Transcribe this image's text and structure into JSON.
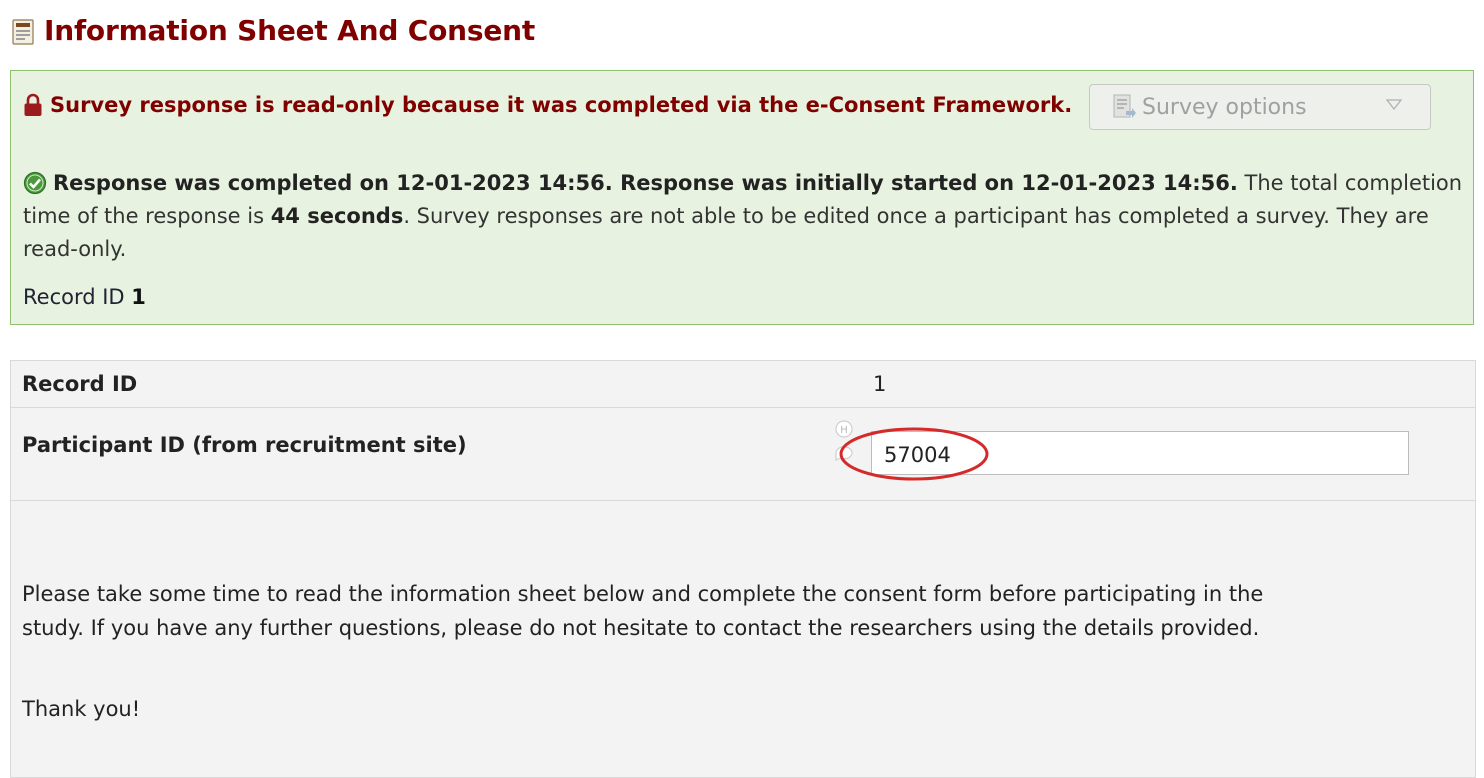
{
  "header": {
    "title": "Information Sheet And Consent"
  },
  "notice": {
    "readonly": "Survey response is read-only because it was completed via the e-Consent Framework.",
    "survey_options_label": "Survey options",
    "completed_bold": "Response was completed on 12-01-2023 14:56. Response was initially started on 12-01-2023 14:56.",
    "total_prefix": " The total completion time of the response is ",
    "total_time": "44 seconds",
    "total_suffix": ". Survey responses are not able to be edited once a participant has completed a survey. They are read-only.",
    "record_label": "Record ID ",
    "record_value": "1"
  },
  "form": {
    "record_id_label": "Record ID",
    "record_id_value": "1",
    "participant_label": "Participant ID (from recruitment site)",
    "participant_value": "57004",
    "intro_text": "Please take some time to read the information sheet below and complete the consent form before participating in the study. If you have any further questions, please do not hesitate to contact the researchers using the details provided.",
    "thanks_text": "Thank you!"
  },
  "colors": {
    "title": "#800000",
    "notice_bg": "#e7f3e0",
    "notice_border": "#8fc06f",
    "annotation": "#d42a2a"
  },
  "icons": {
    "title": "form-icon",
    "readonly": "lock-icon",
    "completion": "check-circle-icon",
    "survey_options": "survey-options-icon",
    "dropdown": "chevron-down-icon",
    "field_history": "field-history-icon"
  }
}
